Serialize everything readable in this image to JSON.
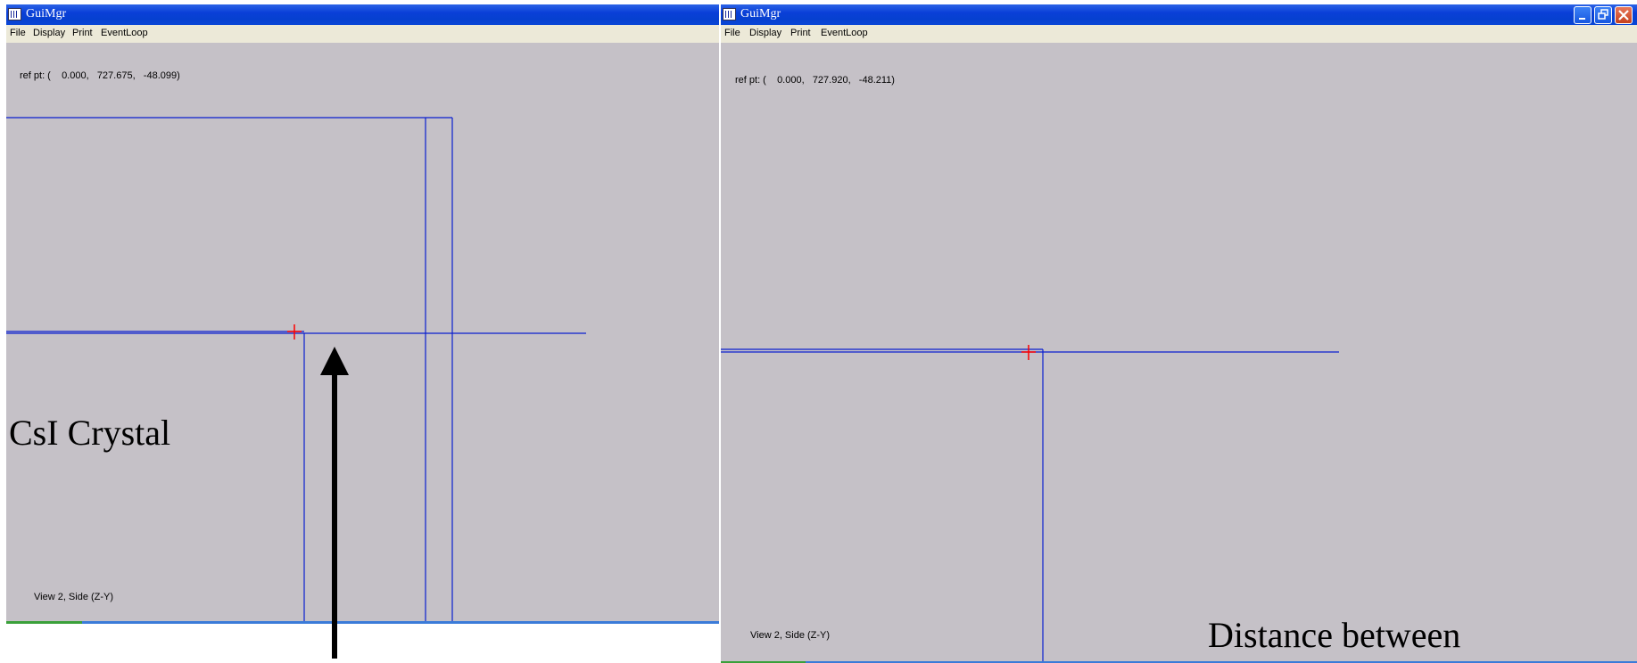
{
  "left_window": {
    "title": "GuiMgr",
    "menu": [
      "File",
      "Display",
      "Print",
      "EventLoop"
    ],
    "ref_point": "ref pt: (    0.000,   727.675,   -48.099)",
    "view_label": "View 2, Side (Z-Y)",
    "annotation": "CsI Crystal"
  },
  "right_window": {
    "title": "GuiMgr",
    "menu": [
      "File",
      "Display",
      "Print",
      "EventLoop"
    ],
    "ref_point": "ref pt: (    0.000,   727.920,   -48.211)",
    "view_label": "View 2, Side (Z-Y)",
    "annotation": "Distance between"
  },
  "colors": {
    "canvas_background": "#c5c1c7",
    "geometry_line": "#0a1fd0",
    "crosshair": "#ff0000",
    "title_bar": "#0a3fd8",
    "arrow": "#000000"
  },
  "icons": [
    "app-icon",
    "minimize-icon",
    "restore-icon",
    "close-icon",
    "crosshair-icon",
    "arrow-icon"
  ]
}
